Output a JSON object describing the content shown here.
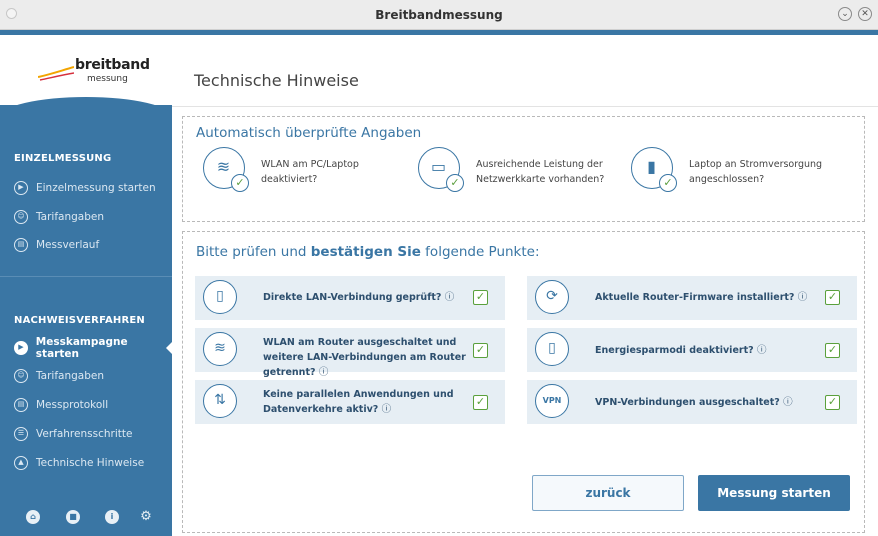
{
  "window": {
    "title": "Breitbandmessung",
    "min_symbol": "⌄",
    "close_symbol": "✕"
  },
  "logo": {
    "name": "breitband",
    "sub": "messung"
  },
  "sidebar": {
    "section1_title": "EINZELMESSUNG",
    "section1_items": [
      {
        "label": "Einzelmessung starten",
        "icon": "play-icon",
        "glyph": "▶"
      },
      {
        "label": "Tarifangaben",
        "icon": "user-tariff-icon",
        "glyph": "☺"
      },
      {
        "label": "Messverlauf",
        "icon": "history-icon",
        "glyph": "▤"
      }
    ],
    "section2_title": "NACHWEISVERFAHREN",
    "section2_items": [
      {
        "label": "Messkampagne starten",
        "icon": "play-icon",
        "glyph": "▶",
        "active": true
      },
      {
        "label": "Tarifangaben",
        "icon": "user-tariff-icon",
        "glyph": "☺"
      },
      {
        "label": "Messprotokoll",
        "icon": "protocol-icon",
        "glyph": "▤"
      },
      {
        "label": "Verfahrensschritte",
        "icon": "steps-icon",
        "glyph": "☰"
      },
      {
        "label": "Technische Hinweise",
        "icon": "warning-icon",
        "glyph": "▲"
      }
    ],
    "footer_icons": [
      {
        "icon": "home-icon",
        "glyph": "⌂"
      },
      {
        "icon": "folder-icon",
        "glyph": "■"
      },
      {
        "icon": "info-icon",
        "glyph": "i"
      },
      {
        "icon": "settings-icon",
        "glyph": "⚙"
      }
    ]
  },
  "main": {
    "title": "Technische Hinweise",
    "auto_heading": "Automatisch überprüfte Angaben",
    "auto_items": [
      {
        "text": "WLAN am PC/Laptop deaktiviert?",
        "icon": "wifi-off-icon",
        "glyph": "≋"
      },
      {
        "text": "Ausreichende Leistung der Netzwerkkarte vorhanden?",
        "icon": "network-card-icon",
        "glyph": "▭"
      },
      {
        "text": "Laptop an Stromversorgung angeschlossen?",
        "icon": "battery-icon",
        "glyph": "▮"
      }
    ],
    "confirm_heading_pre": "Bitte prüfen und ",
    "confirm_heading_bold": "bestätigen Sie",
    "confirm_heading_post": " folgende Punkte:",
    "checks": [
      {
        "text": "Direkte LAN-Verbindung geprüft?",
        "icon": "lan-cable-icon",
        "glyph": "▯",
        "checked": "✓"
      },
      {
        "text": "Aktuelle Router-Firmware installiert?",
        "icon": "refresh-icon",
        "glyph": "⟳",
        "checked": "✓"
      },
      {
        "text": "WLAN am Router ausgeschaltet und weitere LAN-Verbindungen am Router getrennt?",
        "icon": "router-icon",
        "glyph": "≋",
        "checked": "✓"
      },
      {
        "text": "Energiesparmodi deaktiviert?",
        "icon": "energy-icon",
        "glyph": "▯",
        "checked": "✓"
      },
      {
        "text": "Keine parallelen Anwendungen und Datenverkehre aktiv?",
        "icon": "parallel-arrows-icon",
        "glyph": "⇅",
        "checked": "✓"
      },
      {
        "text": "VPN-Verbindungen ausgeschaltet?",
        "icon": "vpn-shield-icon",
        "glyph": "VPN",
        "checked": "✓"
      }
    ],
    "info_symbol": "ⓘ",
    "back_label": "zurück",
    "start_label": "Messung starten"
  }
}
